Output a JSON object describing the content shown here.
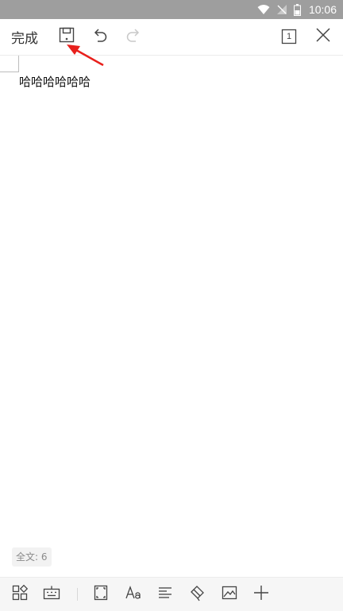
{
  "status_bar": {
    "time": "10:06",
    "icons": [
      "wifi-icon",
      "signal-off-icon",
      "battery-icon"
    ]
  },
  "toolbar": {
    "done_label": "完成",
    "page_number": "1",
    "icons": [
      "save-icon",
      "undo-icon",
      "redo-icon",
      "page-view-icon",
      "close-icon"
    ]
  },
  "document": {
    "text": "哈哈哈哈哈哈"
  },
  "footer": {
    "word_count": "全文: 6"
  },
  "bottom_toolbar": {
    "icons": [
      "apps-icon",
      "keyboard-icon",
      "fullscreen-icon",
      "font-icon",
      "align-icon",
      "format-brush-icon",
      "image-icon",
      "add-icon"
    ]
  },
  "colors": {
    "status_bar": "#9e9e9e",
    "annotation_arrow": "#e8201c",
    "disabled_icon": "#c8c8c8"
  }
}
